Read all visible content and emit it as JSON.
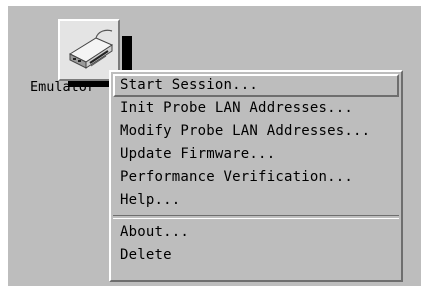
{
  "desktop_icon": {
    "label": "Emulator",
    "icon": "emulator-device-icon"
  },
  "context_menu": {
    "items": [
      {
        "label": "Start Session...",
        "selected": true
      },
      {
        "label": "Init Probe LAN Addresses...",
        "selected": false
      },
      {
        "label": "Modify Probe LAN Addresses...",
        "selected": false
      },
      {
        "label": "Update Firmware...",
        "selected": false
      },
      {
        "label": "Performance Verification...",
        "selected": false
      },
      {
        "label": "Help...",
        "selected": false
      },
      {
        "label": "About...",
        "selected": false
      },
      {
        "label": "Delete",
        "selected": false
      }
    ]
  },
  "colors": {
    "desktop_gray": "#bdbdbd",
    "bevel_light": "#ffffff",
    "bevel_dark": "#6e6e6e"
  }
}
